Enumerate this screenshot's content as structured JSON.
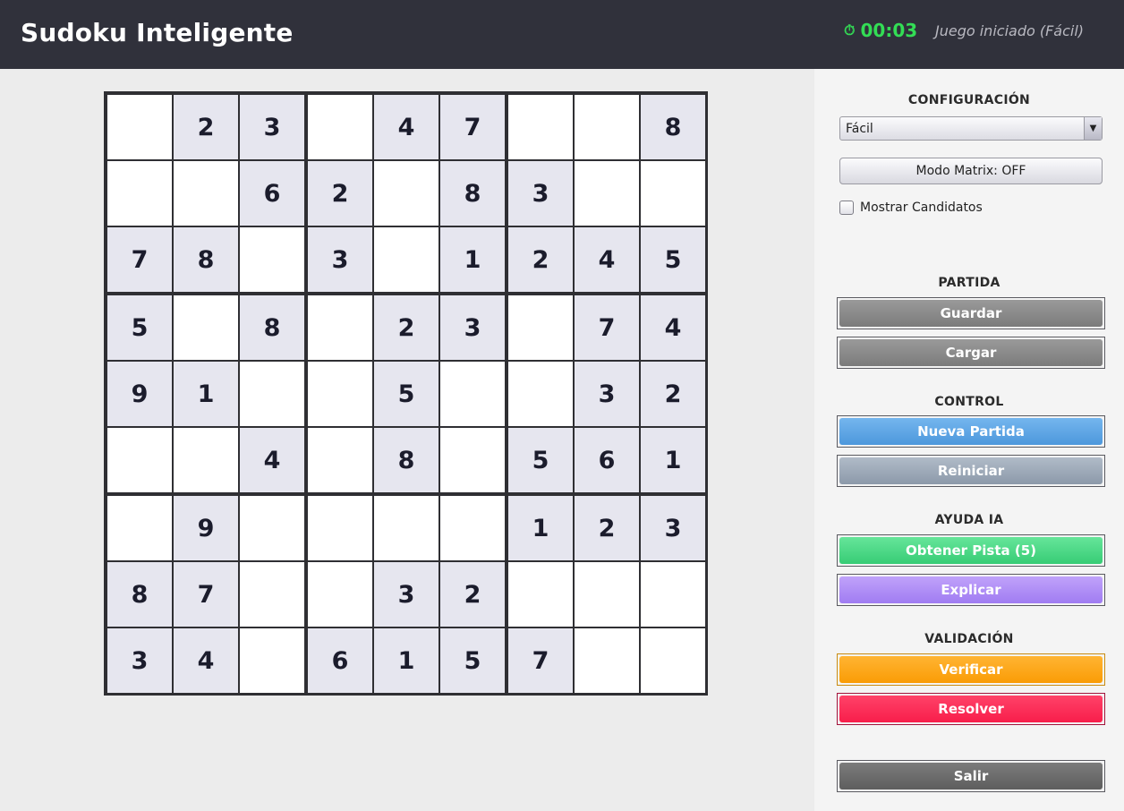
{
  "header": {
    "title": "Sudoku Inteligente",
    "timer_icon": "clock-icon",
    "timer": "00:03",
    "status": "Juego iniciado (Fácil)"
  },
  "board": {
    "rows": [
      [
        "",
        "2",
        "3",
        "",
        "4",
        "7",
        "",
        "",
        "8"
      ],
      [
        "",
        "",
        "6",
        "2",
        "",
        "8",
        "3",
        "",
        ""
      ],
      [
        "7",
        "8",
        "",
        "3",
        "",
        "1",
        "2",
        "4",
        "5"
      ],
      [
        "5",
        "",
        "8",
        "",
        "2",
        "3",
        "",
        "7",
        "4"
      ],
      [
        "9",
        "1",
        "",
        "",
        "5",
        "",
        "",
        "3",
        "2"
      ],
      [
        "",
        "",
        "4",
        "",
        "8",
        "",
        "5",
        "6",
        "1"
      ],
      [
        "",
        "9",
        "",
        "",
        "",
        "",
        "1",
        "2",
        "3"
      ],
      [
        "8",
        "7",
        "",
        "",
        "3",
        "2",
        "",
        "",
        ""
      ],
      [
        "3",
        "4",
        "",
        "6",
        "1",
        "5",
        "7",
        "",
        ""
      ]
    ]
  },
  "panel": {
    "configuracion": {
      "title": "CONFIGURACIÓN",
      "difficulty": "Fácil",
      "matrix_button": "Modo Matrix: OFF",
      "candidates_label": "Mostrar Candidatos",
      "candidates_checked": false
    },
    "partida": {
      "title": "PARTIDA",
      "save": "Guardar",
      "load": "Cargar"
    },
    "control": {
      "title": "CONTROL",
      "new_game": "Nueva Partida",
      "restart": "Reiniciar"
    },
    "ayuda": {
      "title": "AYUDA IA",
      "hint": "Obtener Pista (5)",
      "explain": "Explicar"
    },
    "validacion": {
      "title": "VALIDACIÓN",
      "verify": "Verificar",
      "solve": "Resolver"
    },
    "exit": "Salir"
  },
  "colors": {
    "header_bg": "#30313b",
    "timer": "#33dd55",
    "given_cell": "#e6e6ef",
    "gray_button": "#808080",
    "blue_button": "#5aa6e6",
    "slate_button": "#9aa7b6",
    "green_button": "#45d882",
    "purple_button": "#b08cf6",
    "orange_button": "#ffa615",
    "red_button": "#ff2a55",
    "exit_button": "#6c6c6c"
  }
}
